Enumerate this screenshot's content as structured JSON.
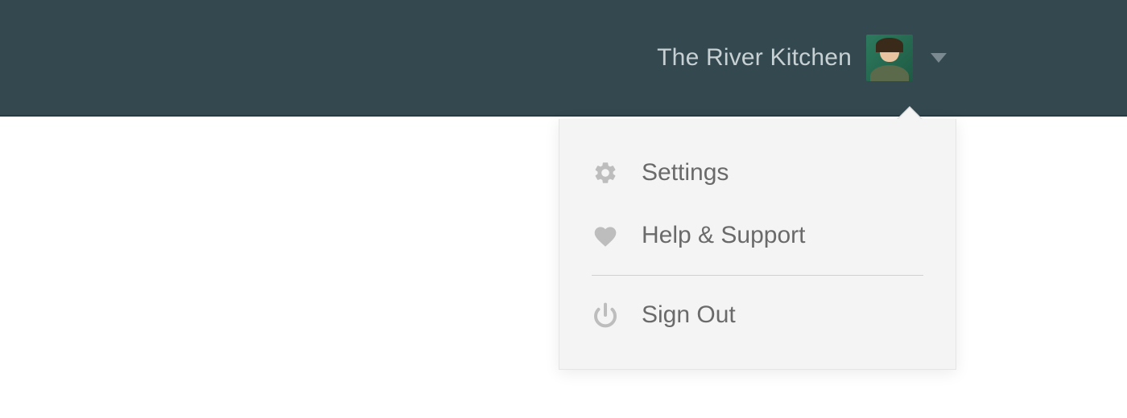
{
  "header": {
    "account_name": "The River Kitchen"
  },
  "dropdown": {
    "items": [
      {
        "label": "Settings",
        "icon": "gear-icon"
      },
      {
        "label": "Help & Support",
        "icon": "heart-icon"
      },
      {
        "label": "Sign Out",
        "icon": "power-icon"
      }
    ]
  },
  "colors": {
    "header_bg": "#33484f",
    "dropdown_bg": "#f4f4f4",
    "text_muted": "#6a6a6a",
    "icon_muted": "#bdbdbd"
  }
}
